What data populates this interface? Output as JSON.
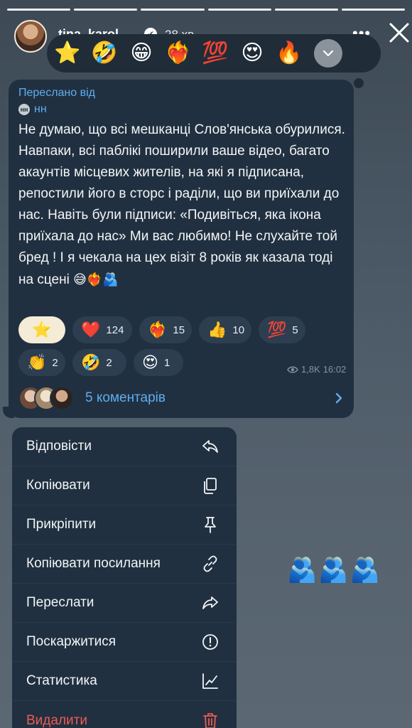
{
  "story": {
    "segments": 6
  },
  "header": {
    "username": "tina_karol",
    "verified": "✔",
    "time": "28 хв",
    "more": "•••"
  },
  "emoji_strip": [
    "⭐",
    "🤣",
    "😁",
    "❤️‍🔥",
    "💯",
    "😍",
    "🔥"
  ],
  "message": {
    "forwarded_label": "Переслано від",
    "source_initials": "нн",
    "source_name": "нн",
    "text": "Не думаю, що всі мешканці Слов'янська обурилися. Навпаки, всі паблікі поширили ваше відео, багато акаунтів місцевих жителів, на які я підписана, репостили його в сторс і раділи, що ви приїхали до нас. Навіть були підписи: «Подивіться, яка ікона приїхала до нас» Ми вас любимо! Не слухайте той бред ! І я чекала на цех візіт 8 років як казала тоді на сцені",
    "text_emoji": "😅❤️‍🔥🫂",
    "reactions": [
      {
        "emoji": "⭐",
        "count": "",
        "selected": true
      },
      {
        "emoji": "❤️",
        "count": "124"
      },
      {
        "emoji": "❤️‍🔥",
        "count": "15"
      },
      {
        "emoji": "👍",
        "count": "10"
      },
      {
        "emoji": "💯",
        "count": "5"
      },
      {
        "emoji": "👏",
        "count": "2"
      },
      {
        "emoji": "🤣",
        "count": "2"
      },
      {
        "emoji": "😍",
        "count": "1"
      }
    ],
    "views": "1,8K",
    "time": "16:02",
    "comments_label": "5 коментарів"
  },
  "menu": [
    {
      "label": "Відповісти",
      "icon": "reply-icon"
    },
    {
      "label": "Копіювати",
      "icon": "copy-icon"
    },
    {
      "label": "Прикріпити",
      "icon": "pin-icon"
    },
    {
      "label": "Копіювати посилання",
      "icon": "link-icon"
    },
    {
      "label": "Переслати",
      "icon": "forward-icon"
    },
    {
      "label": "Поскаржитися",
      "icon": "report-icon"
    },
    {
      "label": "Статистика",
      "icon": "statistics-icon"
    },
    {
      "label": "Видалити",
      "icon": "trash-icon",
      "danger": true
    }
  ],
  "floating_emoji": "🫂🫂🫂",
  "colors": {
    "accent": "#5eaef0",
    "bubble": "#213040",
    "danger": "#ee5a52"
  }
}
